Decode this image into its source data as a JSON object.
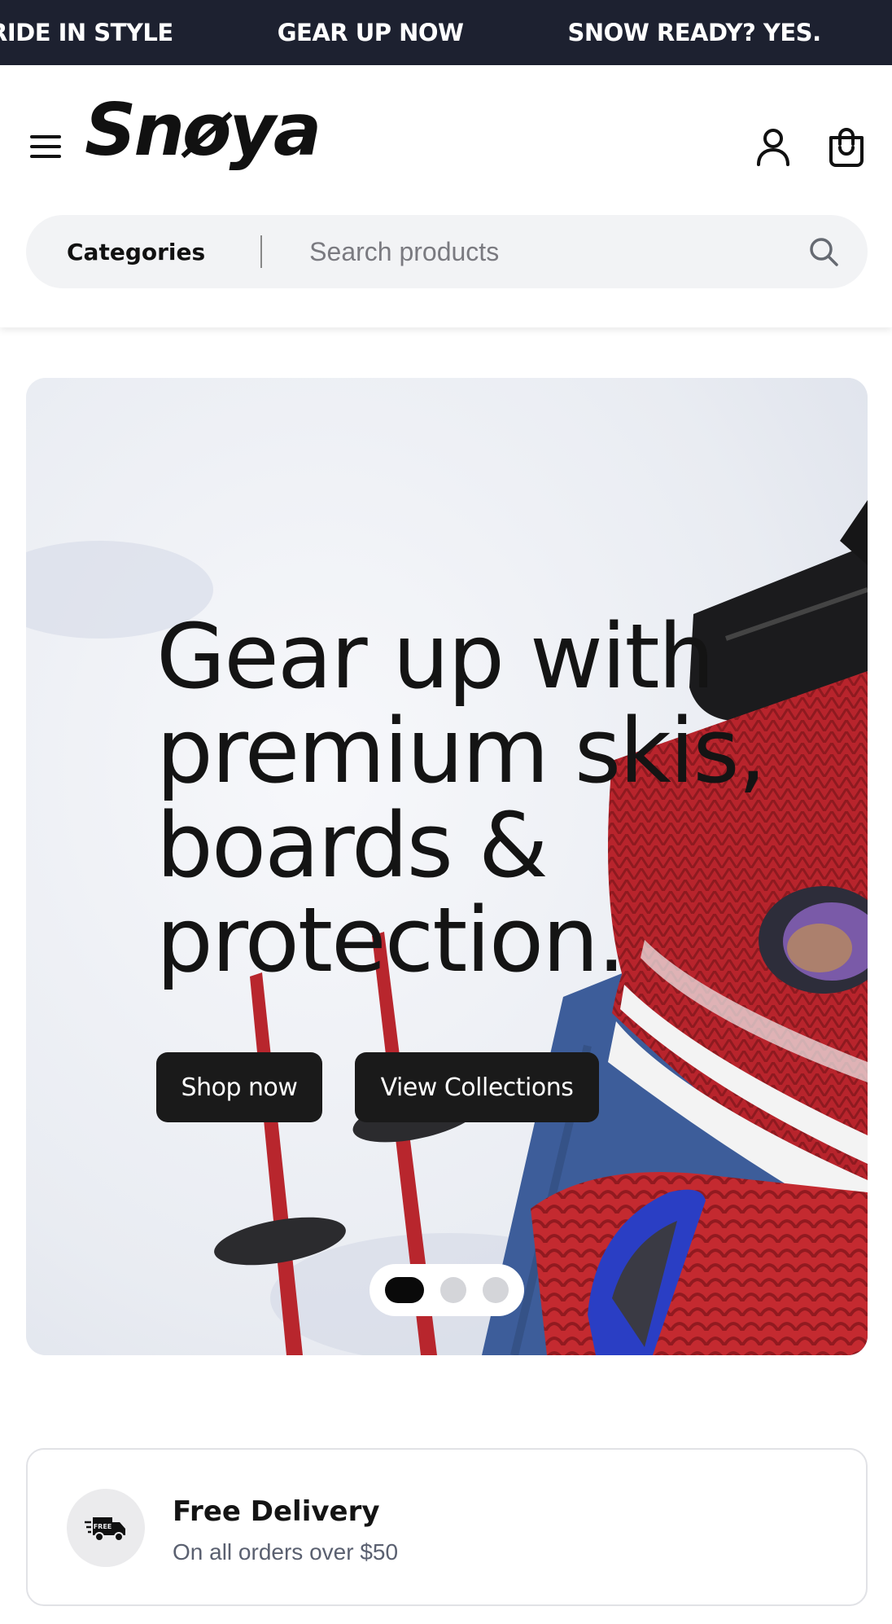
{
  "announcement": {
    "items": [
      "RIDE IN STYLE",
      "GEAR UP NOW",
      "SNOW READY? YES."
    ],
    "background": "#1d2130"
  },
  "header": {
    "logo": "Snøya",
    "menu_icon": "hamburger-menu-icon",
    "account_icon": "user-icon",
    "cart_icon": "shopping-bag-icon"
  },
  "search": {
    "categories_label": "Categories",
    "placeholder": "Search products",
    "icon": "search-icon"
  },
  "hero": {
    "title": "Gear up with premium skis, boards & protection.",
    "primary_button": "Shop now",
    "secondary_button": "View Collections",
    "slides_count": 3,
    "active_slide": 1
  },
  "feature": {
    "icon": "delivery-truck-icon",
    "icon_badge": "FREE",
    "title": "Free Delivery",
    "subtitle": "On all orders over $50"
  },
  "colors": {
    "accent_dark": "#1a1a1a",
    "surface": "#f2f3f5",
    "muted_text": "#5a6070"
  }
}
